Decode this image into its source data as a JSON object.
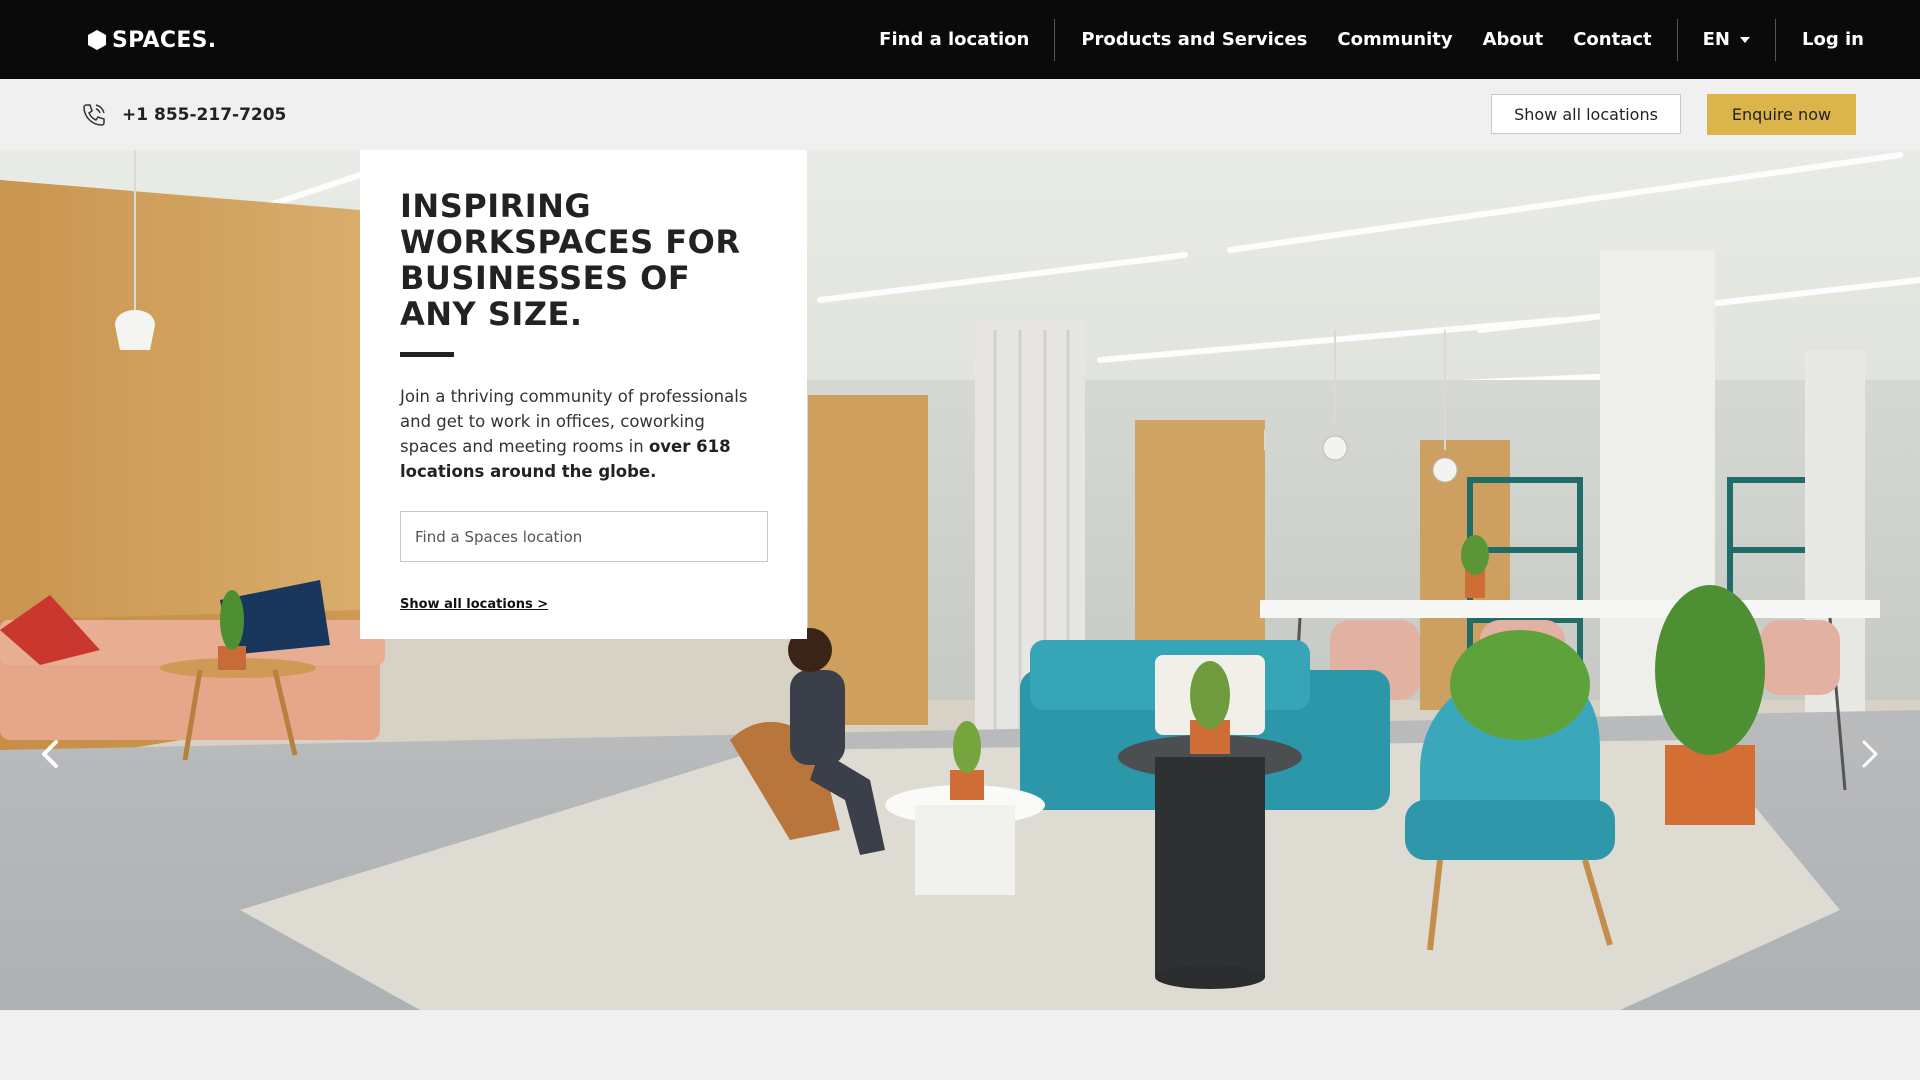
{
  "brand": {
    "name": "SPACES."
  },
  "nav": {
    "items": [
      "Find a location",
      "Products and Services",
      "Community",
      "About",
      "Contact"
    ],
    "language": "EN",
    "login": "Log in"
  },
  "subbar": {
    "phone": "+1 855-217-7205",
    "show_all_locations": "Show all locations",
    "enquire_now": "Enquire now"
  },
  "hero": {
    "title": "INSPIRING WORKSPACES FOR BUSINESSES OF ANY SIZE.",
    "intro_lead": "Join a thriving community of professionals and get to work in offices, coworking spaces and meeting rooms in ",
    "intro_bold": "over 618 locations around the globe.",
    "search_placeholder": "Find a Spaces location",
    "show_all_link": "Show all locations >"
  },
  "colors": {
    "nav_bg": "#0a0a0a",
    "accent_gold": "#dbb54a",
    "page_bg": "#f0f0f0"
  },
  "icons": [
    "spaces-logo-icon",
    "phone-icon",
    "chevron-left-icon",
    "chevron-right-icon",
    "caret-down-icon"
  ]
}
